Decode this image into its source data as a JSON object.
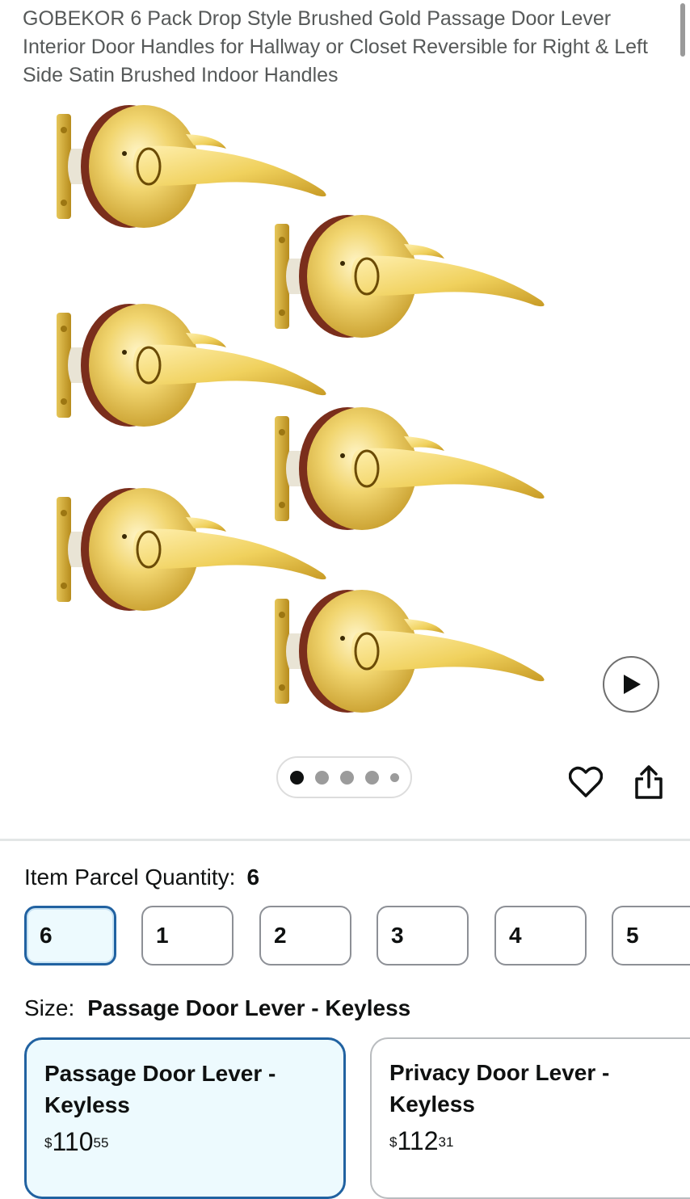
{
  "product": {
    "title": "GOBEKOR 6 Pack Drop Style Brushed Gold Passage Door Lever Interior Door Handles for Hallway or Closet Reversible for Right & Left Side Satin Brushed Indoor Handles",
    "image_alt": "Six brushed gold door lever handles",
    "brand_color": "#d9b53a"
  },
  "gallery": {
    "image_count": 5,
    "current_index": 1,
    "video_icon": "play-icon",
    "favorite_icon": "heart-icon",
    "share_icon": "share-icon"
  },
  "quantity": {
    "label": "Item Parcel Quantity:",
    "selected_value": "6",
    "options": [
      "6",
      "1",
      "2",
      "3",
      "4",
      "5"
    ]
  },
  "size": {
    "label": "Size:",
    "selected_value": "Passage Door Lever - Keyless",
    "options": [
      {
        "name": "Passage Door Lever - Keyless",
        "price_symbol": "$",
        "price_whole": "110",
        "price_fraction": "55",
        "selected": true
      },
      {
        "name": "Privacy Door Lever - Keyless",
        "price_symbol": "$",
        "price_whole": "112",
        "price_fraction": "31",
        "selected": false
      }
    ]
  },
  "colors": {
    "selected_border": "#2162a1",
    "selected_background": "#edfafe",
    "text": "#0f1111"
  }
}
